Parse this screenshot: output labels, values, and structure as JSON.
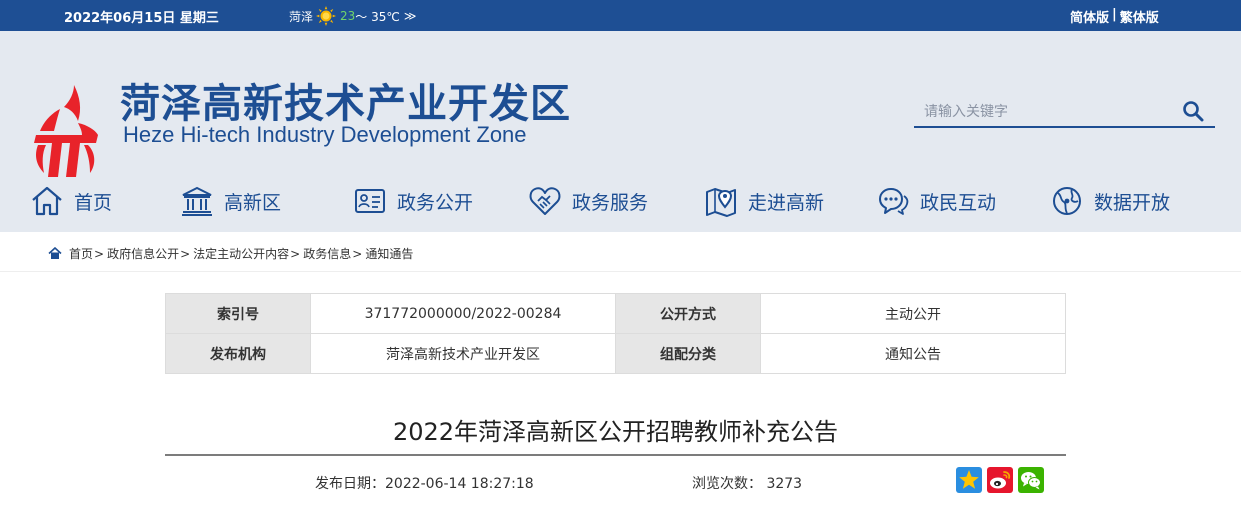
{
  "topbar": {
    "date": "2022年06月15日 星期三",
    "weather_city": "菏泽",
    "weather_low": "23",
    "weather_high": "～ 35℃",
    "weather_more": "≫",
    "lang_simplified": "简体版",
    "lang_sep": "|",
    "lang_traditional": "繁体版"
  },
  "header": {
    "site_name_cn": "菏泽高新技术产业开发区",
    "site_name_en": "Heze Hi-tech Industry Development Zone",
    "brand_color": "#1d4e93",
    "logo_color": "#e8232a"
  },
  "search": {
    "placeholder": "请输入关键字",
    "icon": "search-icon"
  },
  "nav": {
    "items": [
      {
        "label": "首页",
        "icon": "home-icon"
      },
      {
        "label": "高新区",
        "icon": "building-icon"
      },
      {
        "label": "政务公开",
        "icon": "id-card-icon"
      },
      {
        "label": "政务服务",
        "icon": "handshake-heart-icon"
      },
      {
        "label": "走进高新",
        "icon": "map-pin-icon"
      },
      {
        "label": "政民互动",
        "icon": "chat-icon"
      },
      {
        "label": "数据开放",
        "icon": "globe-icon"
      }
    ]
  },
  "breadcrumb": {
    "items": [
      "首页",
      "政府信息公开",
      "法定主动公开内容",
      "政务信息",
      "通知通告"
    ],
    "separator": ">"
  },
  "info_table": {
    "rows": [
      {
        "k1": "索引号",
        "v1": "371772000000/2022-00284",
        "k2": "公开方式",
        "v2": "主动公开"
      },
      {
        "k1": "发布机构",
        "v1": "菏泽高新技术产业开发区",
        "k2": "组配分类",
        "v2": "通知公告"
      }
    ]
  },
  "article": {
    "title": "2022年菏泽高新区公开招聘教师补充公告",
    "publish_label": "发布日期：",
    "publish_date": "2022-06-14 18:27:18",
    "views_label": "浏览次数：",
    "views": "3273",
    "share_icons": [
      "qzone-star-icon",
      "weibo-icon",
      "wechat-icon"
    ]
  }
}
